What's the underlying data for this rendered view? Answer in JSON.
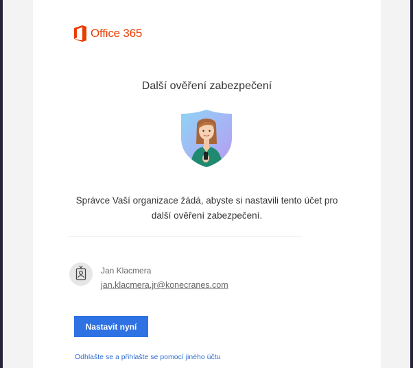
{
  "brand": {
    "name": "Office 365",
    "logo_icon": "office-logo-icon",
    "accent_color": "#eb3c00"
  },
  "page": {
    "title": "Další ověření zabezpečení",
    "illustration_icon": "security-shield-person-icon",
    "message": "Správce Vaší organizace žádá, abyste si nastavili tento účet pro další ověření zabezpečení."
  },
  "account": {
    "avatar_icon": "badge-person-icon",
    "name": "Jan Klacmera",
    "email": "jan.klacmera.jr@konecranes.com"
  },
  "actions": {
    "setup_now_label": "Nastavit nyní",
    "switch_account_label": "Odhlašte se a přihlašte se pomocí jiného účtu",
    "primary_color": "#2f72e3",
    "link_color": "#2f6fd3"
  }
}
